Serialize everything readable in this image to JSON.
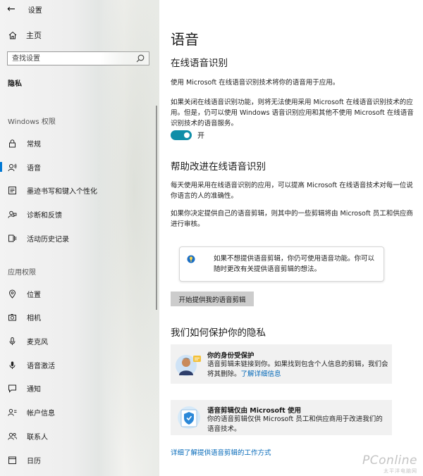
{
  "window": {
    "back_icon": "back-arrow-icon",
    "title": "设置"
  },
  "sidebar": {
    "home_label": "主页",
    "search_placeholder": "查找设置",
    "current_section": "隐私",
    "groups": [
      {
        "label": "Windows 权限"
      },
      {
        "label": "应用权限"
      }
    ],
    "items": [
      {
        "label": "常规",
        "icon": "lock-icon"
      },
      {
        "label": "语音",
        "icon": "speech-icon",
        "active": true
      },
      {
        "label": "墨迹书写和键入个性化",
        "icon": "pen-keyboard-icon"
      },
      {
        "label": "诊断和反馈",
        "icon": "feedback-icon"
      },
      {
        "label": "活动历史记录",
        "icon": "history-icon"
      },
      {
        "label": "位置",
        "icon": "location-icon"
      },
      {
        "label": "相机",
        "icon": "camera-icon"
      },
      {
        "label": "麦克风",
        "icon": "microphone-icon"
      },
      {
        "label": "语音激活",
        "icon": "voice-activation-icon"
      },
      {
        "label": "通知",
        "icon": "notification-icon"
      },
      {
        "label": "帐户信息",
        "icon": "account-info-icon"
      },
      {
        "label": "联系人",
        "icon": "contacts-icon"
      },
      {
        "label": "日历",
        "icon": "calendar-icon"
      }
    ]
  },
  "main": {
    "title": "语音",
    "online_speech": {
      "heading": "在线语音识别",
      "p1": "使用 Microsoft 在线语音识别技术将你的语音用于应用。",
      "p2": "如果关闭在线语音识别功能，则将无法使用采用 Microsoft 在线语音识别技术的应用。但是，仍可以使用 Windows 语音识别应用和其他不使用 Microsoft 在线语音识别技术的语音服务。",
      "toggle_state": "开"
    },
    "improve": {
      "heading": "帮助改进在线语音识别",
      "p1": "每天使用采用在线语音识别的应用，可以提高 Microsoft 在线语音技术对每一位说你语言的人的准确性。",
      "p2": "如果你决定提供自己的语音剪辑，则其中的一些剪辑将由 Microsoft 员工和供应商进行审核。",
      "tip": "如果不想提供语音剪辑，你仍可使用语音功能。你可以随时更改有关提供语音剪辑的想法。",
      "button_label": "开始提供我的语音剪辑"
    },
    "privacy": {
      "heading": "我们如何保护你的隐私",
      "card1_title": "你的身份受保护",
      "card1_body": "语音剪辑未链接到你。如果找到包含个人信息的剪辑，我们会将其删除。",
      "card1_link": "了解详细信息",
      "card2_title": "语音剪辑仅由 Microsoft 使用",
      "card2_body": "你的语音剪辑仅供 Microsoft 员工和供应商用于改进我们的语音技术。"
    },
    "bottom_link": "详细了解提供语音剪辑的工作方式"
  },
  "watermark": {
    "brand": "PConline",
    "sub": "太平洋电脑网"
  },
  "colors": {
    "accent": "#0078d4",
    "toggle_on": "#0f8ea8",
    "link": "#0067b8"
  }
}
